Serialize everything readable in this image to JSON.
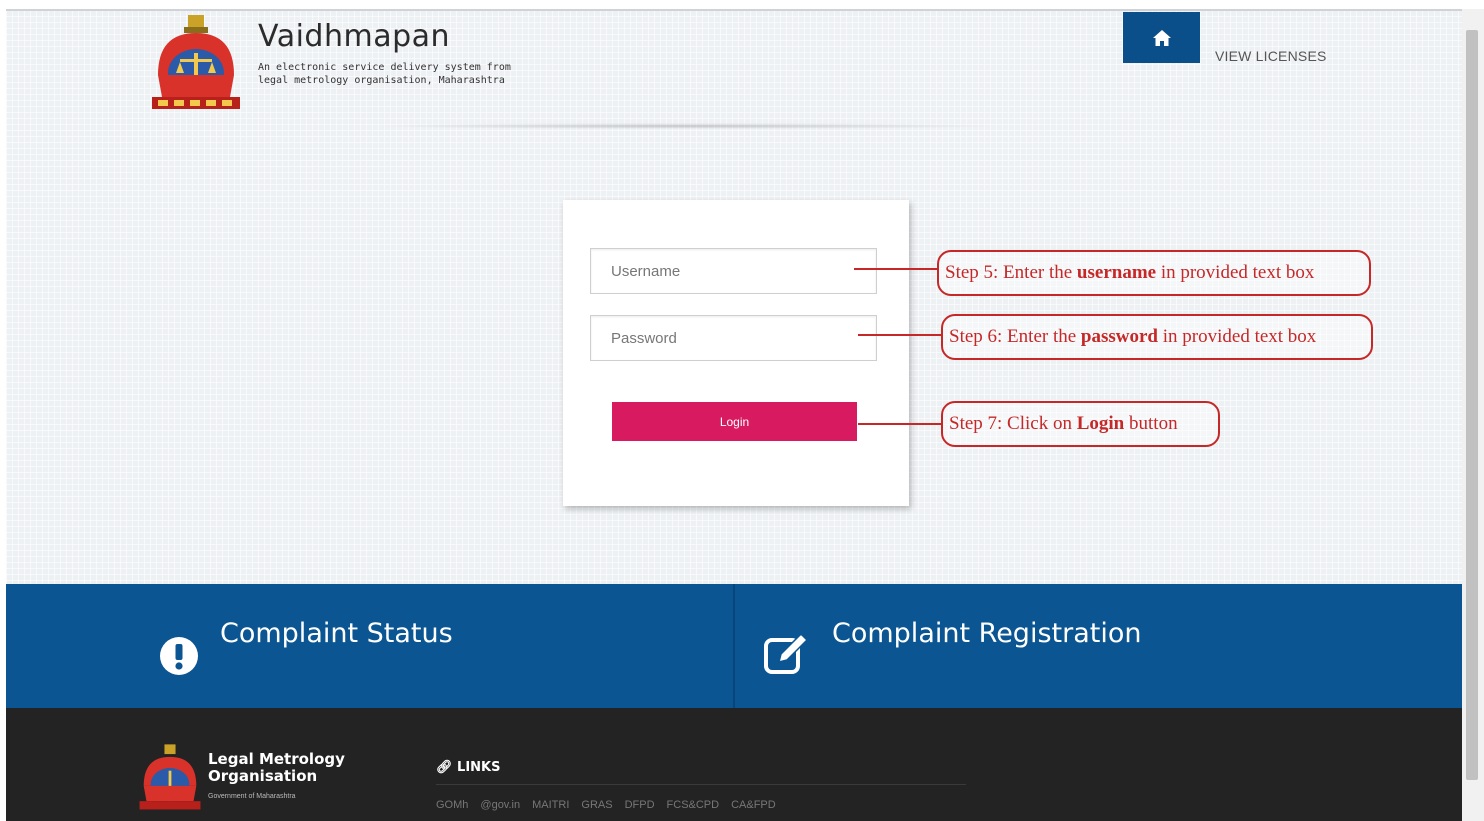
{
  "header": {
    "title": "Vaidhmapan",
    "subtitle_line1": "An electronic service delivery system from",
    "subtitle_line2": "legal metrology organisation, Maharashtra",
    "home_icon": "home-icon",
    "view_licenses": "VIEW LICENSES"
  },
  "login": {
    "username_placeholder": "Username",
    "password_placeholder": "Password",
    "login_label": "Login"
  },
  "annotations": {
    "step5": {
      "prefix": "Step 5: Enter the ",
      "bold": "username",
      "suffix": " in provided text box"
    },
    "step6": {
      "prefix": "Step 6: Enter the ",
      "bold": "password",
      "suffix": " in provided text box"
    },
    "step7": {
      "prefix": "Step 7: Click on ",
      "bold": "Login",
      "suffix": " button"
    },
    "color": "#c62828"
  },
  "band": {
    "complaint_status": "Complaint Status",
    "complaint_registration": "Complaint Registration",
    "status_icon": "exclamation-circle-icon",
    "registration_icon": "edit-icon",
    "color": "#0a5592"
  },
  "footer": {
    "org_line1": "Legal Metrology",
    "org_line2": "Organisation",
    "gov": "Government of Maharashtra",
    "links_title": "LINKS",
    "links": [
      "GOMh",
      "@gov.in",
      "MAITRI",
      "GRAS",
      "DFPD",
      "FCS&CPD",
      "CA&FPD"
    ]
  },
  "colors": {
    "login_button": "#d81b60",
    "home_button": "#0b4f8a",
    "footer_bg": "#232323"
  }
}
